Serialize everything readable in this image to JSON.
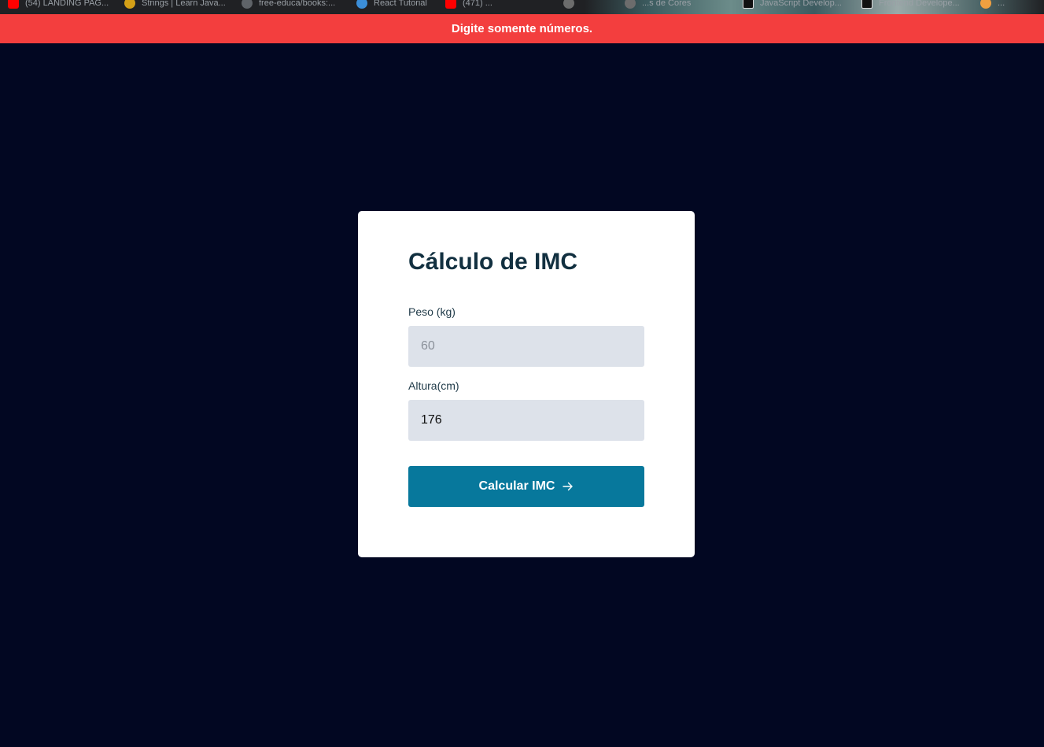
{
  "bookmarks_bar": {
    "items": [
      {
        "label": "(54) LANDING PAG...",
        "icon": "youtube-icon"
      },
      {
        "label": "Strings | Learn Java...",
        "icon": "js-icon"
      },
      {
        "label": "free-educa/books:...",
        "icon": "github-icon"
      },
      {
        "label": "React Tutorial",
        "icon": "react-icon"
      },
      {
        "label": "(471) ...",
        "icon": "youtube-icon"
      },
      {
        "label": "",
        "icon": "globe-icon"
      },
      {
        "label": "...s de Cores",
        "icon": "code-icon"
      },
      {
        "label": "JavaScript Develop...",
        "icon": "dev-icon"
      },
      {
        "label": "Frontend Develope...",
        "icon": "dev-icon"
      },
      {
        "label": "...",
        "icon": "chrome-icon"
      }
    ]
  },
  "toast": {
    "message": "Digite somente números.",
    "color": "#f33e3e"
  },
  "card": {
    "title": "Cálculo de IMC",
    "peso": {
      "label": "Peso (kg)",
      "placeholder": "60",
      "value": ""
    },
    "altura": {
      "label": "Altura(cm)",
      "placeholder": "",
      "value": "176"
    },
    "button_label": "Calcular IMC",
    "button_color": "#07789c"
  },
  "colors": {
    "background": "#020722",
    "card": "#ffffff",
    "input_bg": "#dde2ea"
  }
}
